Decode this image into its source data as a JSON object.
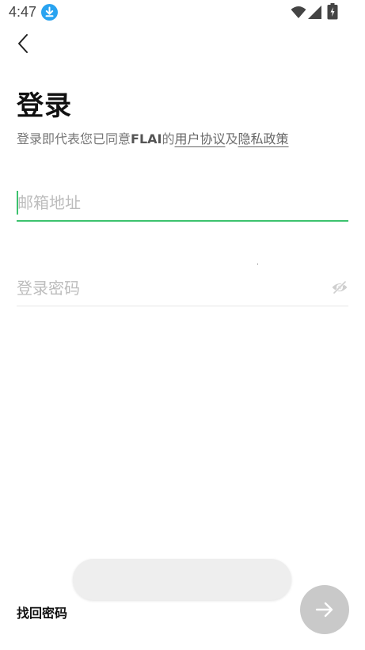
{
  "status_bar": {
    "time": "4:47",
    "icons": [
      "download-icon",
      "wifi-icon",
      "signal-icon",
      "battery-icon"
    ],
    "download_color": "#29a3f0"
  },
  "header": {
    "back_icon": "chevron-left-icon",
    "title": "登录"
  },
  "agreement": {
    "prefix": "登录即代表您已同意",
    "brand": "FLAI",
    "connector1": "的",
    "terms_link": "用户协议",
    "connector2": "及",
    "privacy_link": "隐私政策"
  },
  "form": {
    "email": {
      "placeholder": "邮箱地址",
      "value": ""
    },
    "password": {
      "placeholder": "登录密码",
      "value": "",
      "toggle_icon": "eye-off-icon"
    }
  },
  "footer": {
    "forgot_password": "找回密码",
    "submit_icon": "arrow-right-icon"
  },
  "colors": {
    "accent": "#3cc26e",
    "submit_disabled": "#c9c9c9",
    "placeholder": "#bdbdbd"
  }
}
